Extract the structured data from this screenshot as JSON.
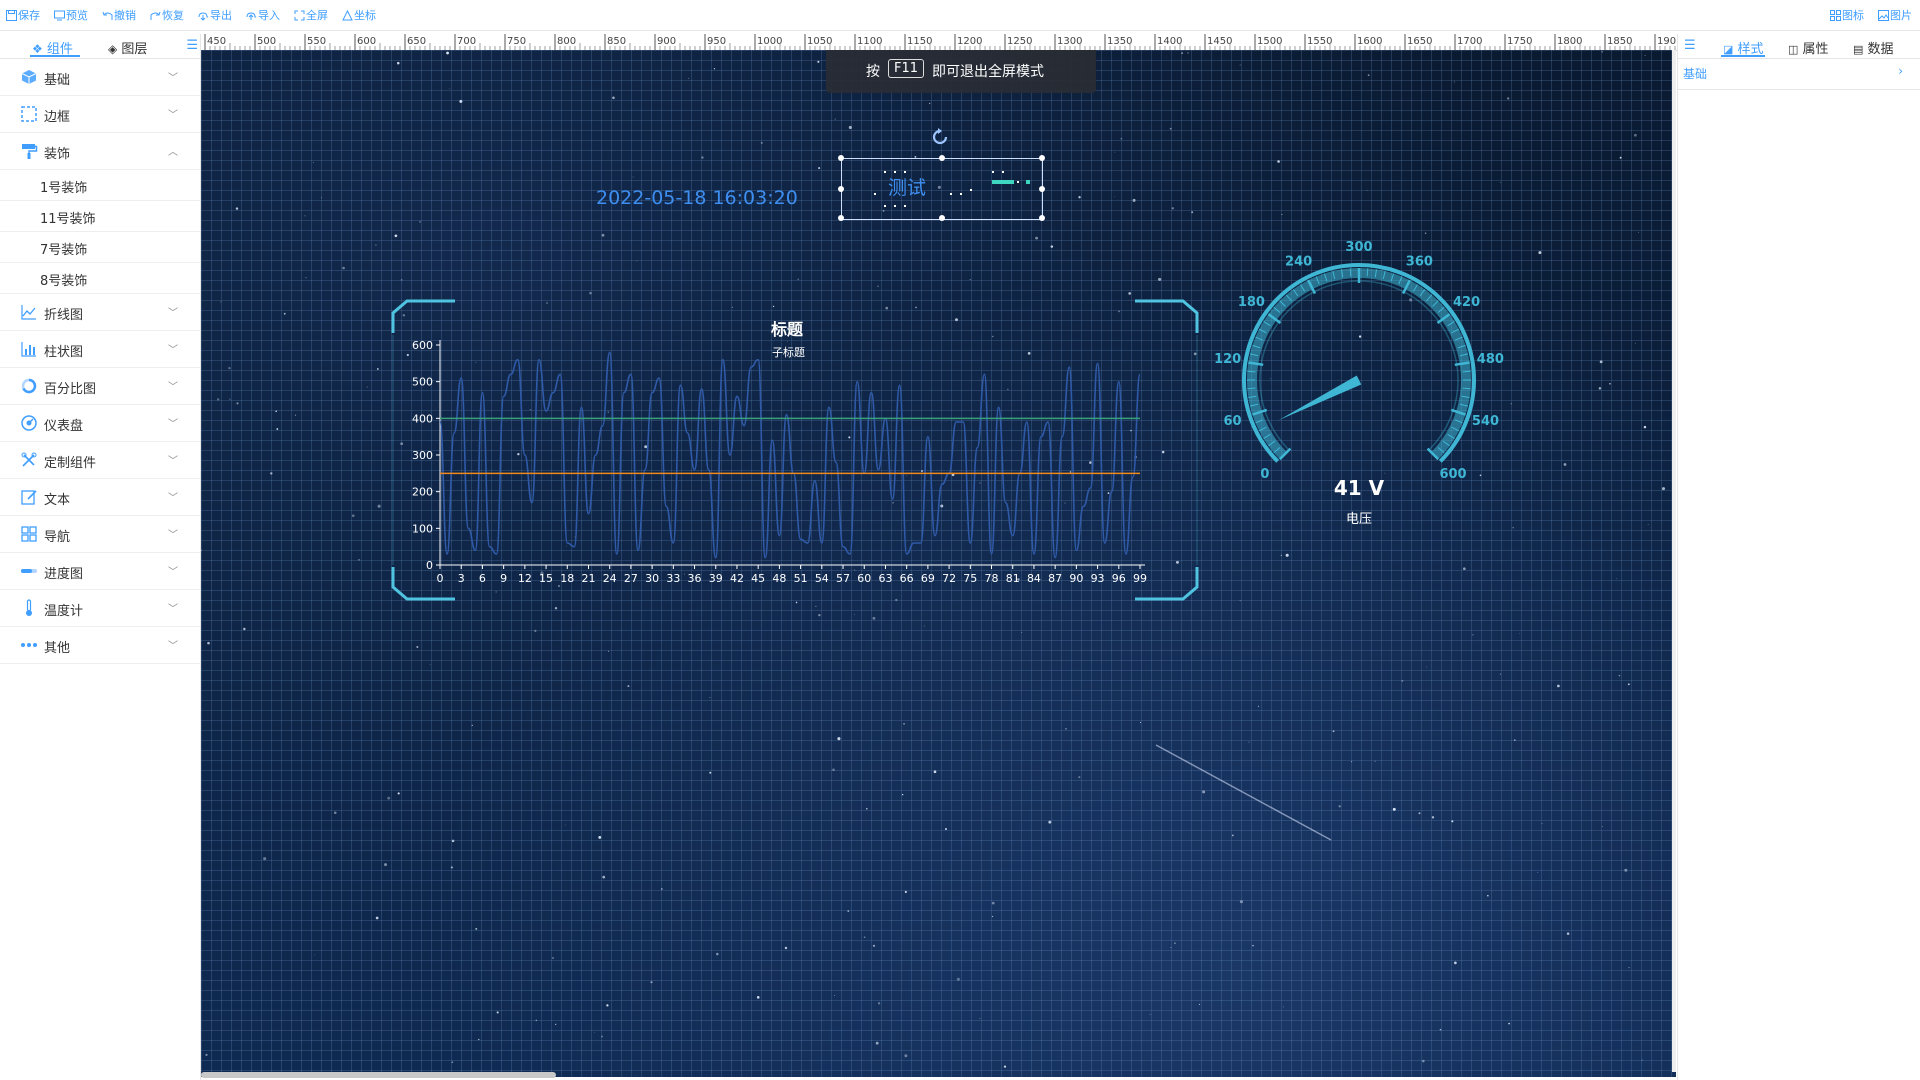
{
  "toolbar": {
    "items": [
      {
        "label": "保存",
        "icon": "save-icon"
      },
      {
        "label": "预览",
        "icon": "preview-icon"
      },
      {
        "label": "撤销",
        "icon": "undo-icon"
      },
      {
        "label": "恢复",
        "icon": "redo-icon"
      },
      {
        "label": "导出",
        "icon": "export-icon"
      },
      {
        "label": "导入",
        "icon": "import-icon"
      },
      {
        "label": "全屏",
        "icon": "fullscreen-icon"
      },
      {
        "label": "坐标",
        "icon": "coordinate-icon"
      }
    ],
    "right_items": [
      {
        "label": "图标",
        "icon": "icon-library-icon"
      },
      {
        "label": "图片",
        "icon": "image-icon"
      }
    ]
  },
  "left_panel": {
    "tabs": [
      {
        "label": "组件",
        "active": true
      },
      {
        "label": "图层",
        "active": false
      }
    ],
    "categories": [
      {
        "label": "基础",
        "expanded": false
      },
      {
        "label": "边框",
        "expanded": false
      },
      {
        "label": "装饰",
        "expanded": true,
        "children": [
          "1号装饰",
          "11号装饰",
          "7号装饰",
          "8号装饰"
        ]
      },
      {
        "label": "折线图",
        "expanded": false
      },
      {
        "label": "柱状图",
        "expanded": false
      },
      {
        "label": "百分比图",
        "expanded": false
      },
      {
        "label": "仪表盘",
        "expanded": false
      },
      {
        "label": "定制组件",
        "expanded": false
      },
      {
        "label": "文本",
        "expanded": false
      },
      {
        "label": "导航",
        "expanded": false
      },
      {
        "label": "进度图",
        "expanded": false
      },
      {
        "label": "温度计",
        "expanded": false
      },
      {
        "label": "其他",
        "expanded": false
      }
    ]
  },
  "ruler": {
    "labels": [
      "450",
      "500",
      "550",
      "600",
      "650",
      "700",
      "750",
      "800",
      "850",
      "900",
      "950",
      "1000",
      "1050",
      "1100",
      "1150",
      "1200",
      "1250",
      "1300",
      "1350",
      "1400",
      "1450",
      "1500",
      "1550",
      "1600",
      "1650",
      "1700",
      "1750",
      "1800",
      "1850",
      "190"
    ]
  },
  "canvas": {
    "fullscreen_hint": {
      "prefix": "按",
      "key": "F11",
      "suffix": "即可退出全屏模式"
    },
    "timestamp": "2022-05-18 16:03:20",
    "decoration_text": "测试"
  },
  "chart_data": [
    {
      "type": "line",
      "title": "标题",
      "subtitle": "子标题",
      "x_ticks": [
        "0",
        "3",
        "6",
        "9",
        "12",
        "15",
        "18",
        "21",
        "24",
        "27",
        "30",
        "33",
        "36",
        "39",
        "42",
        "45",
        "48",
        "51",
        "54",
        "57",
        "60",
        "63",
        "66",
        "69",
        "72",
        "75",
        "78",
        "81",
        "84",
        "87",
        "90",
        "93",
        "96",
        "99"
      ],
      "ylim": [
        0,
        600
      ],
      "y_ticks": [
        "0",
        "100",
        "200",
        "300",
        "400",
        "500",
        "600"
      ],
      "x": [
        0,
        1,
        2,
        3,
        4,
        5,
        6,
        7,
        8,
        9,
        10,
        11,
        12,
        13,
        14,
        15,
        16,
        17,
        18,
        19,
        20,
        21,
        22,
        23,
        24,
        25,
        26,
        27,
        28,
        29,
        30,
        31,
        32,
        33,
        34,
        35,
        36,
        37,
        38,
        39,
        40,
        41,
        42,
        43,
        44,
        45,
        46,
        47,
        48,
        49,
        50,
        51,
        52,
        53,
        54,
        55,
        56,
        57,
        58,
        59,
        60,
        61,
        62,
        63,
        64,
        65,
        66,
        67,
        68,
        69,
        70,
        71,
        72,
        73,
        74,
        75,
        76,
        77,
        78,
        79,
        80,
        81,
        82,
        83,
        84,
        85,
        86,
        87,
        88,
        89,
        90,
        91,
        92,
        93,
        94,
        95,
        96,
        97,
        98,
        99
      ],
      "series": [
        {
          "color": "#2f5aa8",
          "values": [
            390,
            30,
            360,
            510,
            100,
            40,
            470,
            50,
            30,
            460,
            520,
            560,
            300,
            170,
            560,
            420,
            470,
            520,
            60,
            50,
            430,
            140,
            300,
            380,
            580,
            30,
            470,
            520,
            40,
            260,
            470,
            510,
            160,
            60,
            490,
            360,
            260,
            480,
            260,
            20,
            560,
            300,
            460,
            380,
            540,
            560,
            20,
            340,
            80,
            410,
            250,
            70,
            60,
            230,
            60,
            430,
            280,
            50,
            30,
            500,
            250,
            470,
            260,
            400,
            180,
            490,
            30,
            60,
            60,
            350,
            80,
            220,
            250,
            390,
            390,
            60,
            320,
            520,
            30,
            430,
            170,
            80,
            250,
            390,
            30,
            350,
            390,
            20,
            350,
            540,
            40,
            160,
            210,
            550,
            60,
            200,
            500,
            30,
            240,
            520
          ]
        },
        {
          "color": "#3aa27a",
          "values": [
            400,
            400,
            400,
            400,
            400,
            400,
            400,
            400,
            400,
            400,
            400,
            400,
            400,
            400,
            400,
            400,
            400,
            400,
            400,
            400,
            400,
            400,
            400,
            400,
            400,
            400,
            400,
            400,
            400,
            400,
            400,
            400,
            400,
            400,
            400,
            400,
            400,
            400,
            400,
            400,
            400,
            400,
            400,
            400,
            400,
            400,
            400,
            400,
            400,
            400,
            400,
            400,
            400,
            400,
            400,
            400,
            400,
            400,
            400,
            400,
            400,
            400,
            400,
            400,
            400,
            400,
            400,
            400,
            400,
            400,
            400,
            400,
            400,
            400,
            400,
            400,
            400,
            400,
            400,
            400,
            400,
            400,
            400,
            400,
            400,
            400,
            400,
            400,
            400,
            400,
            400,
            400,
            400,
            400,
            400,
            400,
            400,
            400,
            400,
            400
          ]
        },
        {
          "color": "#f0891a",
          "values": [
            250,
            250,
            250,
            250,
            250,
            250,
            250,
            250,
            250,
            250,
            250,
            250,
            250,
            250,
            250,
            250,
            250,
            250,
            250,
            250,
            250,
            250,
            250,
            250,
            250,
            250,
            250,
            250,
            250,
            250,
            250,
            250,
            250,
            250,
            250,
            250,
            250,
            250,
            250,
            250,
            250,
            250,
            250,
            250,
            250,
            250,
            250,
            250,
            250,
            250,
            250,
            250,
            250,
            250,
            250,
            250,
            250,
            250,
            250,
            250,
            250,
            250,
            250,
            250,
            250,
            250,
            250,
            250,
            250,
            250,
            250,
            250,
            250,
            250,
            250,
            250,
            250,
            250,
            250,
            250,
            250,
            250,
            250,
            250,
            250,
            250,
            250,
            250,
            250,
            250,
            250,
            250,
            250,
            250,
            250,
            250,
            250,
            250,
            250,
            250
          ]
        }
      ]
    },
    {
      "type": "gauge",
      "min": 0,
      "max": 600,
      "tick_labels": [
        "0",
        "60",
        "120",
        "180",
        "240",
        "300",
        "360",
        "420",
        "480",
        "540",
        "600"
      ],
      "value": 41,
      "value_text": "41 V",
      "label": "电压",
      "color": "#3fb7d4"
    }
  ],
  "right_panel": {
    "tabs": [
      {
        "label": "样式",
        "icon": "style-icon",
        "active": true
      },
      {
        "label": "属性",
        "icon": "property-icon",
        "active": false
      },
      {
        "label": "数据",
        "icon": "data-icon",
        "active": false
      }
    ],
    "section": "基础"
  }
}
